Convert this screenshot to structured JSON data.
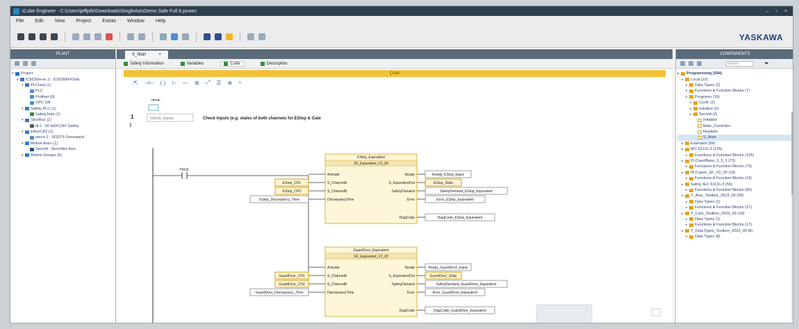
{
  "window": {
    "title": "iCube Engineer - C:\\Users\\jeffpile\\Downloads\\SingleAxisDemo Safe Full 8.pcwex"
  },
  "menu": [
    "File",
    "Edit",
    "View",
    "Project",
    "Extras",
    "Window",
    "Help"
  ],
  "brand": "YASKAWA",
  "plant": {
    "header": "PLANT",
    "tree": [
      {
        "label": "Project",
        "depth": 0,
        "color": "#2a6fb8"
      },
      {
        "label": "iC9226m-ec:1 : iC9226M-FSoE",
        "depth": 1,
        "color": "#3a78c4"
      },
      {
        "label": "PLCnext (1)",
        "depth": 2,
        "color": "#3a78c4"
      },
      {
        "label": "PLC",
        "depth": 3,
        "color": "#4c8fd4"
      },
      {
        "label": "Profinet (0)",
        "depth": 3,
        "color": "#4c8fd4"
      },
      {
        "label": "OPC UA",
        "depth": 3,
        "color": "#4c8fd4"
      },
      {
        "label": "Safety PLC (1)",
        "depth": 2,
        "color": "#3a78c4"
      },
      {
        "label": "SafetyTask (1)",
        "depth": 3,
        "color": "#2f8f3f"
      },
      {
        "label": "SliceBus (1)",
        "depth": 2,
        "color": "#3a78c4"
      },
      {
        "label": "di-1 : DI 4xDC24V Safety",
        "depth": 3,
        "color": "#556"
      },
      {
        "label": "EtherCAT (1)",
        "depth": 2,
        "color": "#3a78c4"
      },
      {
        "label": "servo-1 : SGD7S Servopack",
        "depth": 3,
        "color": "#4c8fd4"
      },
      {
        "label": "Motion Axes (1)",
        "depth": 2,
        "color": "#3a78c4"
      },
      {
        "label": "ServoA : ServoNet Axis",
        "depth": 3,
        "color": "#2a4f8e"
      },
      {
        "label": "Motion Groups (0)",
        "depth": 2,
        "color": "#3a78c4"
      }
    ]
  },
  "editor": {
    "tab_label": "S_Main",
    "tab_close": "×",
    "subtabs": [
      "Safety Information",
      "Variables",
      "Code",
      "Description"
    ],
    "code_bar": "Code",
    "network_label": "NCE",
    "network_number": "1",
    "network_name": "Check_Inputs",
    "network_comment": "Check Inputs (e.g. states of both channels for EStop & Gate",
    "contact_label": "TRUE",
    "blocks": [
      {
        "instance": "EStop_Equivalent",
        "type": "SF_Equivalent_V2_00",
        "inputs": [
          "Activate",
          "S_ChannelA",
          "S_ChannelB",
          "DiscrepancyTime"
        ],
        "outputs": [
          "Ready",
          "S_EquivalentOut",
          "SafetyDemand",
          "Error",
          "DiagCode"
        ],
        "in_vars": [
          "EStop_CH1",
          "EStop_CH2",
          "EStop_Discrepancy_Time"
        ],
        "out_vars": [
          "Ready_EStop_Equiv",
          "EStop_State",
          "SafetyDemand_EStop_Equivalent",
          "Error_EStop_Equivalent",
          "DiagCode_EStop_Equivalent"
        ]
      },
      {
        "instance": "GuardDoor_Equivalent",
        "type": "SF_Equivalent_V2_00",
        "inputs": [
          "Activate",
          "S_ChannelA",
          "S_ChannelB",
          "DiscrepancyTime"
        ],
        "outputs": [
          "Ready",
          "S_EquivalentOut",
          "SafetyDemand",
          "Error",
          "DiagCode"
        ],
        "in_vars": [
          "GuardDoor_CH1",
          "GuardDoor_CH2",
          "GuardDoor_Discrepancy_Time"
        ],
        "out_vars": [
          "Ready_GuardDoor_Equiv",
          "GuardDoor_State",
          "SafetyDemand_GuardDoor_Equivalent",
          "Error_GuardDoor_Equivalent",
          "DiagCode_GuardDoor_Equivalent"
        ]
      }
    ]
  },
  "components": {
    "header": "COMPONENTS",
    "search_placeholder": "Search",
    "tree": [
      {
        "label": "Programming (594)",
        "depth": 0,
        "bold": true
      },
      {
        "label": "Local (19)",
        "depth": 1
      },
      {
        "label": "Data Types (2)",
        "depth": 2
      },
      {
        "label": "Functions & Function Blocks (7)",
        "depth": 2
      },
      {
        "label": "Programs (10)",
        "depth": 2
      },
      {
        "label": "Cyclic (2)",
        "depth": 3
      },
      {
        "label": "Initialize (2)",
        "depth": 3
      },
      {
        "label": "ServoA (2)",
        "depth": 3
      },
      {
        "label": "Initialize",
        "depth": 4
      },
      {
        "label": "Main_Controller",
        "depth": 4
      },
      {
        "label": "Readme",
        "depth": 4
      },
      {
        "label": "S_Main",
        "depth": 4,
        "selected": true
      },
      {
        "label": "Extended (84)",
        "depth": 1
      },
      {
        "label": "IEC 61131-3 (126)",
        "depth": 1
      },
      {
        "label": "Functions & Function Blocks (126)",
        "depth": 2
      },
      {
        "label": "PLCnextBase_1_5_1 (73)",
        "depth": 1
      },
      {
        "label": "Functions & Function Blocks (73)",
        "depth": 2
      },
      {
        "label": "PLCopen_SF_V2_00 (19)",
        "depth": 1
      },
      {
        "label": "Functions & Function Blocks (19)",
        "depth": 2
      },
      {
        "label": "Safety IEC 61131-3 (56)",
        "depth": 1
      },
      {
        "label": "Functions & Function Blocks (56)",
        "depth": 2
      },
      {
        "label": "Y_Axis_Toolbox_2023_09 (28)",
        "depth": 1
      },
      {
        "label": "Data Types (1)",
        "depth": 2
      },
      {
        "label": "Functions & Function Blocks (27)",
        "depth": 2
      },
      {
        "label": "Y_Cam_Toolbox_2023_09 (18)",
        "depth": 1
      },
      {
        "label": "Data Types (1)",
        "depth": 2
      },
      {
        "label": "Functions & Function Blocks (17)",
        "depth": 2
      },
      {
        "label": "Y_DataTypes_Toolbox_2023_09 (8)",
        "depth": 1
      },
      {
        "label": "Data Types (8)",
        "depth": 2
      }
    ]
  }
}
